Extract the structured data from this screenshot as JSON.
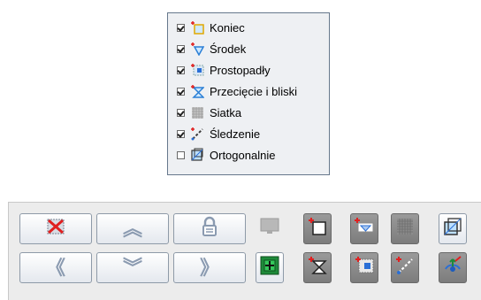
{
  "snap_menu": {
    "items": [
      {
        "label": "Koniec",
        "checked": true,
        "icon": "endpoint-snap-icon"
      },
      {
        "label": "Środek",
        "checked": true,
        "icon": "midpoint-snap-icon"
      },
      {
        "label": "Prostopadły",
        "checked": true,
        "icon": "perpendicular-snap-icon"
      },
      {
        "label": "Przecięcie i bliski",
        "checked": true,
        "icon": "intersection-snap-icon"
      },
      {
        "label": "Siatka",
        "checked": true,
        "icon": "grid-snap-icon"
      },
      {
        "label": "Śledzenie",
        "checked": true,
        "icon": "tracking-snap-icon"
      },
      {
        "label": "Ortogonalnie",
        "checked": false,
        "icon": "orthogonal-snap-icon"
      }
    ]
  },
  "toolbar": {
    "row1": [
      "delete-selection-icon",
      "chevron-up-icon",
      "lock-icon",
      "monitor-icon",
      "endpoint-snap-icon",
      "midpoint-snap-icon",
      "grid-snap-icon",
      "orthogonal-snap-icon"
    ],
    "row2": [
      "chevron-left-icon",
      "chevron-down-icon",
      "chevron-right-icon",
      "zoom-fit-icon",
      "intersection-snap-icon",
      "perpendicular-snap-icon",
      "tracking-snap-icon",
      "view-rotate-icon"
    ],
    "colors": {
      "button_border": "#8e9aa8",
      "active_button": "#8a8a8a",
      "accent_red": "#e02020",
      "accent_blue": "#2a6fd6"
    }
  }
}
